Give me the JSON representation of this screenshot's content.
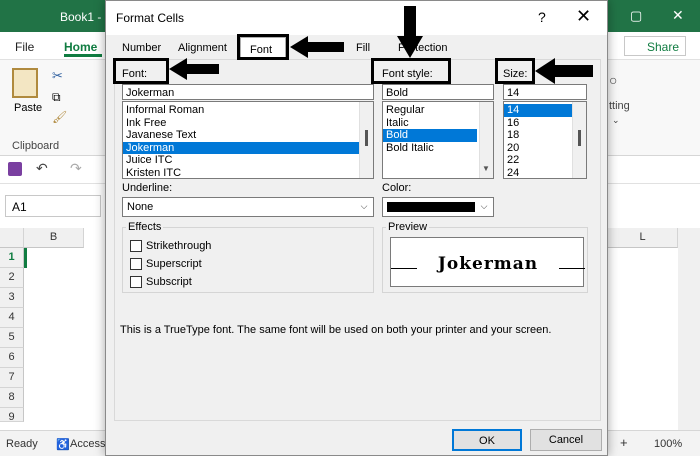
{
  "excel": {
    "title": "Book1 -",
    "tabs": [
      "File",
      "Home"
    ],
    "share": "Share",
    "ribbon_paste": "Paste",
    "ribbon_clipboard": "Clipboard",
    "ribbon_right": "tting",
    "namebox": "A1",
    "col_b": "B",
    "col_l": "L",
    "rows": [
      "1",
      "2",
      "3",
      "4",
      "5",
      "6",
      "7",
      "8",
      "9"
    ],
    "status_ready": "Ready",
    "status_access": "Accessi",
    "zoom": "100%"
  },
  "dialog": {
    "title": "Format Cells",
    "help": "?",
    "close": "✕",
    "tabs": [
      "Number",
      "Alignment",
      "Font",
      "Fill",
      "Protection"
    ],
    "font_label": "Font:",
    "font_value": "Jokerman",
    "font_list": [
      "Informal Roman",
      "Ink Free",
      "Javanese Text",
      "Jokerman",
      "Juice ITC",
      "Kristen ITC"
    ],
    "font_selected": 3,
    "style_label": "Font style:",
    "style_value": "Bold",
    "style_list": [
      "Regular",
      "Italic",
      "Bold",
      "Bold Italic"
    ],
    "style_selected": 2,
    "size_label": "Size:",
    "size_value": "14",
    "size_list": [
      "14",
      "16",
      "18",
      "20",
      "22",
      "24"
    ],
    "size_selected": 0,
    "underline_label": "Underline:",
    "underline_value": "None",
    "color_label": "Color:",
    "color_value": "#000000",
    "effects_label": "Effects",
    "effects": [
      "Strikethrough",
      "Superscript",
      "Subscript"
    ],
    "preview_label": "Preview",
    "preview_text": "Jokerman",
    "note": "This is a TrueType font.  The same font will be used on both your printer and your screen.",
    "ok": "OK",
    "cancel": "Cancel"
  }
}
